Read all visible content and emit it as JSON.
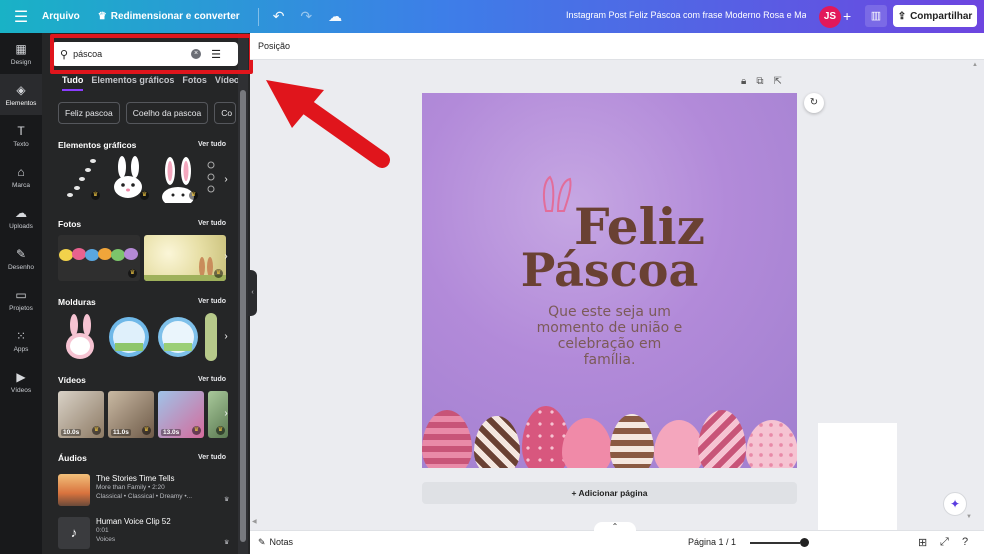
{
  "topbar": {
    "file_menu": "Arquivo",
    "resize_label": "Redimensionar e converter",
    "doc_title": "Instagram Post Feliz Páscoa com frase Moderno Rosa e Mar...",
    "avatar_initials": "JS",
    "share_label": "Compartilhar",
    "gradient_colors": [
      "#19b2c6",
      "#3d7ee8",
      "#6d45e0"
    ]
  },
  "rail": {
    "items": [
      {
        "label": "Design",
        "icon": "design-icon"
      },
      {
        "label": "Elementos",
        "icon": "elements-icon"
      },
      {
        "label": "Texto",
        "icon": "text-icon"
      },
      {
        "label": "Marca",
        "icon": "brand-icon"
      },
      {
        "label": "Uploads",
        "icon": "upload-icon"
      },
      {
        "label": "Desenho",
        "icon": "draw-icon"
      },
      {
        "label": "Projetos",
        "icon": "folder-icon"
      },
      {
        "label": "Apps",
        "icon": "apps-icon"
      },
      {
        "label": "Vídeos",
        "icon": "video-icon"
      }
    ]
  },
  "panel": {
    "search_value": "páscoa",
    "tabs": [
      "Tudo",
      "Elementos gráficos",
      "Fotos",
      "Vídeos"
    ],
    "chips": [
      "Feliz pascoa",
      "Coelho da pascoa",
      "Co"
    ],
    "sections": {
      "graphics": {
        "title": "Elementos gráficos",
        "see_all": "Ver tudo"
      },
      "photos": {
        "title": "Fotos",
        "see_all": "Ver tudo"
      },
      "frames": {
        "title": "Molduras",
        "see_all": "Ver tudo"
      },
      "videos": {
        "title": "Vídeos",
        "see_all": "Ver tudo",
        "durations": [
          "10.0s",
          "11.0s",
          "13.0s",
          ""
        ]
      },
      "audio": {
        "title": "Áudios",
        "see_all": "Ver tudo"
      }
    },
    "audio_items": [
      {
        "title": "The Stories Time Tells",
        "line1": "More than Family • 2:20",
        "line2": "Classical • Classical • Dreamy •..."
      },
      {
        "title": "Human Voice Clip 52",
        "line1": "0:01",
        "line2": "Voices"
      }
    ]
  },
  "canvas": {
    "subtoolbar_label": "Posição",
    "design_title_1": "Feliz",
    "design_title_2": "Páscoa",
    "design_subtitle": "Que este seja um momento de união e celebração em família.",
    "add_page": "+ Adicionar página",
    "accent_color": "#6a4133"
  },
  "bottombar": {
    "notes": "Notas",
    "page_indicator": "Página 1 / 1"
  }
}
